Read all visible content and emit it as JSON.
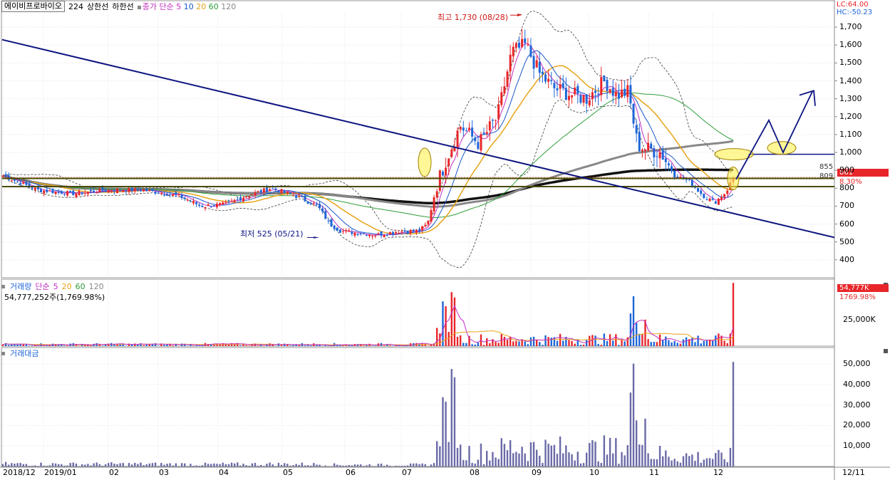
{
  "header": {
    "stock_name": "에이비프로바이오",
    "period": "224",
    "upper_label": "상한선",
    "lower_label": "하한선",
    "ma_prefix": "종가 단순",
    "ma_periods": [
      "5",
      "10",
      "20",
      "60",
      "120"
    ],
    "lc_label": "LC:64.00",
    "hc_label": "HC:-50.23"
  },
  "colors": {
    "up": "#e8262a",
    "down": "#1e66d8",
    "ma5": "#c22fc2",
    "ma10": "#1b56c9",
    "ma20": "#e7a317",
    "ma60": "#2f9d3a",
    "ma120": "#888888",
    "ma224": "#111111",
    "trend": "#0c1480",
    "amount": "#6a6aa8",
    "hline": "#4a4a00"
  },
  "chart_data": [
    {
      "type": "candlestick",
      "ylim": [
        300,
        1780
      ],
      "y_ticks": [
        400,
        500,
        600,
        700,
        800,
        900,
        "1,000",
        "1,100",
        "1,200",
        "1,300",
        "1,400",
        "1,500",
        "1,600",
        "1,700"
      ],
      "x_labels": [
        "2018/12",
        "2019/01",
        "02",
        "03",
        "04",
        "05",
        "06",
        "07",
        "08",
        "09",
        "10",
        "11",
        "12"
      ],
      "last_date_label": "12/11",
      "levels": [
        {
          "label": "855",
          "value": 855
        },
        {
          "label": "809",
          "value": 809
        }
      ],
      "current": {
        "price_label": "861",
        "change_label": "8.30%",
        "value": 861
      },
      "high_annotation": {
        "text": "최고 1,730 (08/28)",
        "value": 1730
      },
      "low_annotation": {
        "text": "최저 525 (05/21)",
        "value": 525
      },
      "target_level": 990,
      "trendline": [
        {
          "x": 0,
          "y": 1630
        },
        {
          "x": 1,
          "y": 525
        }
      ]
    },
    {
      "type": "bar",
      "title": "거래량",
      "ma_prefix": "단순",
      "ma_periods": [
        "5",
        "20",
        "60",
        "120"
      ],
      "value_label": "54,777,252주(1,769.98%)",
      "y_tick": "25,000K",
      "last_label": "54,777K",
      "last_pct": "1769.98%",
      "ylim": [
        0,
        58000000
      ],
      "last_value": 54777252
    },
    {
      "type": "bar",
      "title": "거래대금",
      "y_ticks": [
        "10,000",
        "20,000",
        "30,000",
        "40,000",
        "50,000"
      ],
      "ylim": [
        0,
        58000
      ],
      "last_value": 51000
    }
  ]
}
